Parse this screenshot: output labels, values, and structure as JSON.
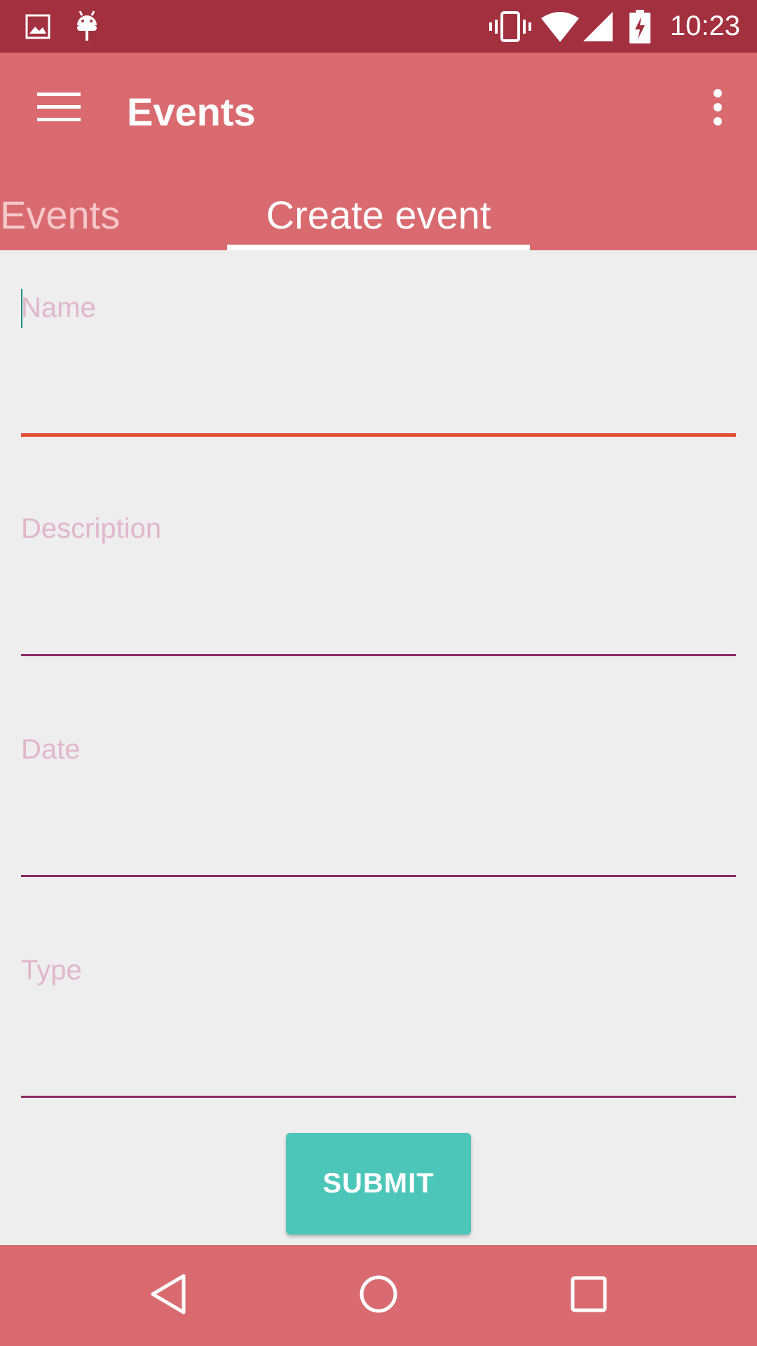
{
  "status_bar": {
    "time": "10:23",
    "icons": [
      "image-icon",
      "android-icon",
      "vibrate-icon",
      "wifi-icon",
      "signal-icon",
      "battery-charging-icon"
    ]
  },
  "app_bar": {
    "title": "Events",
    "menu_icon": "hamburger-menu-icon",
    "overflow_icon": "more-vertical-icon"
  },
  "tabs": [
    {
      "label": "Events",
      "selected": false
    },
    {
      "label": "Create event",
      "selected": true
    }
  ],
  "form": {
    "fields": [
      {
        "name": "name",
        "placeholder": "Name",
        "value": ""
      },
      {
        "name": "description",
        "placeholder": "Description",
        "value": ""
      },
      {
        "name": "date",
        "placeholder": "Date",
        "value": ""
      },
      {
        "name": "type",
        "placeholder": "Type",
        "value": ""
      }
    ],
    "submit_label": "SUBMIT"
  },
  "nav_bar": {
    "icons": [
      "back-icon",
      "home-icon",
      "recents-icon"
    ]
  },
  "colors": {
    "status_bar": "#A2303E",
    "app_bar": "#D96B70",
    "background": "#EEEEEE",
    "hint": "#E1B7C9",
    "underline": "#8B2A63",
    "underline_active": "#E14E34",
    "button": "#4CC6B8"
  }
}
